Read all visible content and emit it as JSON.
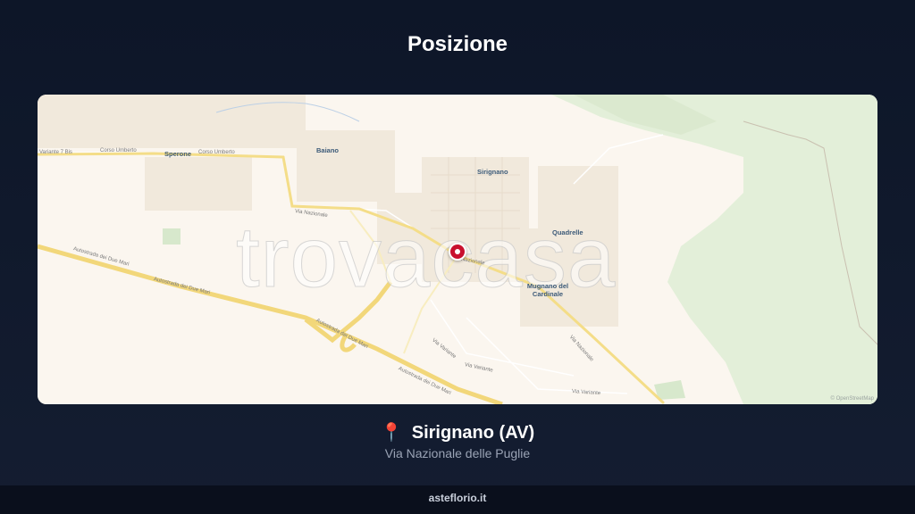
{
  "header": {
    "title": "Posizione"
  },
  "map": {
    "watermark": "trovacasa",
    "attribution": "© OpenStreetMap",
    "places": {
      "baiano": "Baiano",
      "sperone": "Sperone",
      "sirignano": "Sirignano",
      "quadrelle": "Quadrelle",
      "mugnano": "Mugnano del Cardinale"
    },
    "roads": {
      "variante": "Variante 7 Bis",
      "corso1": "Corso Umberto",
      "corso2": "Corso Umberto",
      "via_nazionale_w": "Via Nazionale",
      "via_nazionale_c": "Via Nazionale",
      "via_nazionale_e": "Via Nazionale",
      "autostrada1": "Autostrada dei Due Mari",
      "autostrada2": "Autostrada dei Due Mari",
      "autostrada3": "Autostrada dei Due Mari",
      "autostrada4": "Autostrada dei Due Mari",
      "via_variante1": "Via Variante",
      "via_variante2": "Via Variante",
      "via_variante3": "Via Variante"
    },
    "marker_color": "#c8102e",
    "land_color": "#fbf6ef",
    "green_color": "#e3efd9",
    "road_color": "#f7e8a0"
  },
  "location": {
    "pin_icon": "📍",
    "name": "Sirignano (AV)",
    "address": "Via Nazionale delle Puglie"
  },
  "footer": {
    "brand": "asteflorio.it"
  }
}
